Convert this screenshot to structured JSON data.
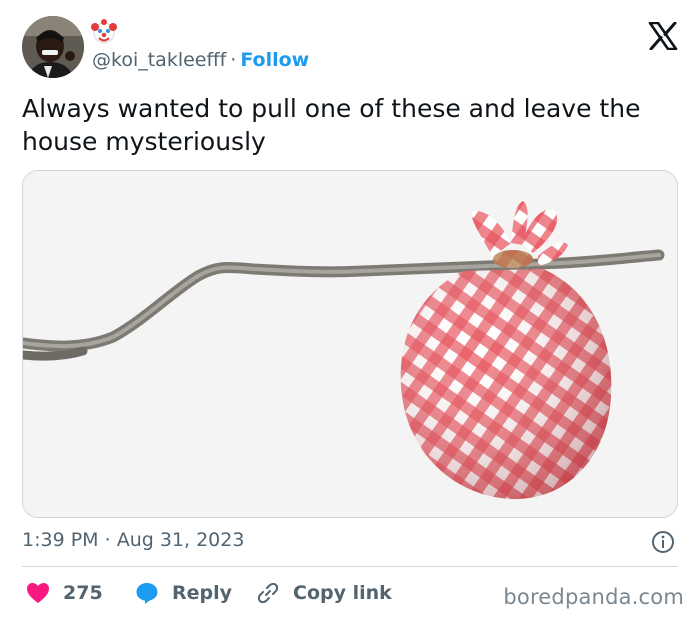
{
  "user": {
    "handle": "@koi_takleefff",
    "separator": "·",
    "follow_label": "Follow",
    "emoji": "clown-face"
  },
  "tweet": {
    "text": "Always wanted to pull one of these and leave the house mysteriously"
  },
  "meta": {
    "time": "1:39 PM",
    "separator": "·",
    "date": "Aug 31, 2023"
  },
  "actions": {
    "like_count": "275",
    "reply_label": "Reply",
    "copy_label": "Copy link"
  },
  "watermark": "boredpanda.com",
  "colors": {
    "like_red": "#f91880",
    "reply_blue": "#1d9bf0",
    "follow_blue": "#1d9bf0",
    "muted": "#536471"
  },
  "icons": [
    "x-logo-icon",
    "clown-emoji-icon",
    "info-icon",
    "heart-icon",
    "reply-bubble-icon",
    "link-icon"
  ]
}
